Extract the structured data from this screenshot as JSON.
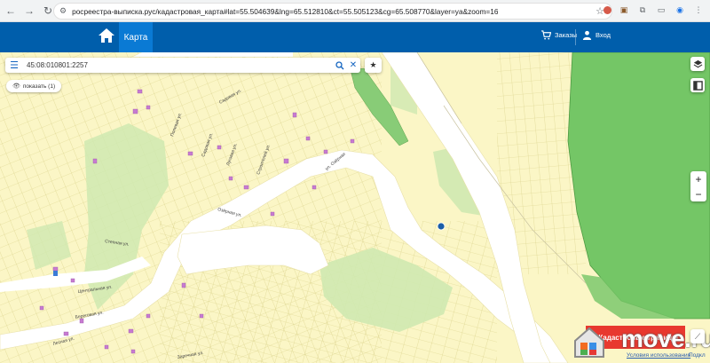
{
  "browser": {
    "url": "росреестра-выписка.рус/кадастровая_карта#lat=55.504639&lng=65.512810&ct=55.505123&cg=65.508770&layer=ya&zoom=16"
  },
  "header": {
    "tab_map": "Карта",
    "orders_label": "Заказы",
    "login_label": "Вход"
  },
  "search": {
    "value": "45:08:010801:2257"
  },
  "show_button": "показать (1)",
  "map": {
    "labels": [
      "Садовая ул.",
      "Полевая ул.",
      "Садовая ул.",
      "Луговая ул.",
      "Строителей ул.",
      "ул. Озёрная",
      "Озёрная ул.",
      "Степная ул.",
      "Центральная ул.",
      "Береговая ул.",
      "Лесная ул.",
      "Заречная ул."
    ],
    "accent_blue": "#005eab",
    "parcel_fill": "#fbf6c6",
    "marker_color": "#1a5ea8"
  },
  "zoom": {
    "in": "+",
    "out": "−"
  },
  "banner_text": "Кадастровые границы",
  "watermark": "move.ru",
  "attribution": "Условия использования",
  "attribution2": "Подкл"
}
